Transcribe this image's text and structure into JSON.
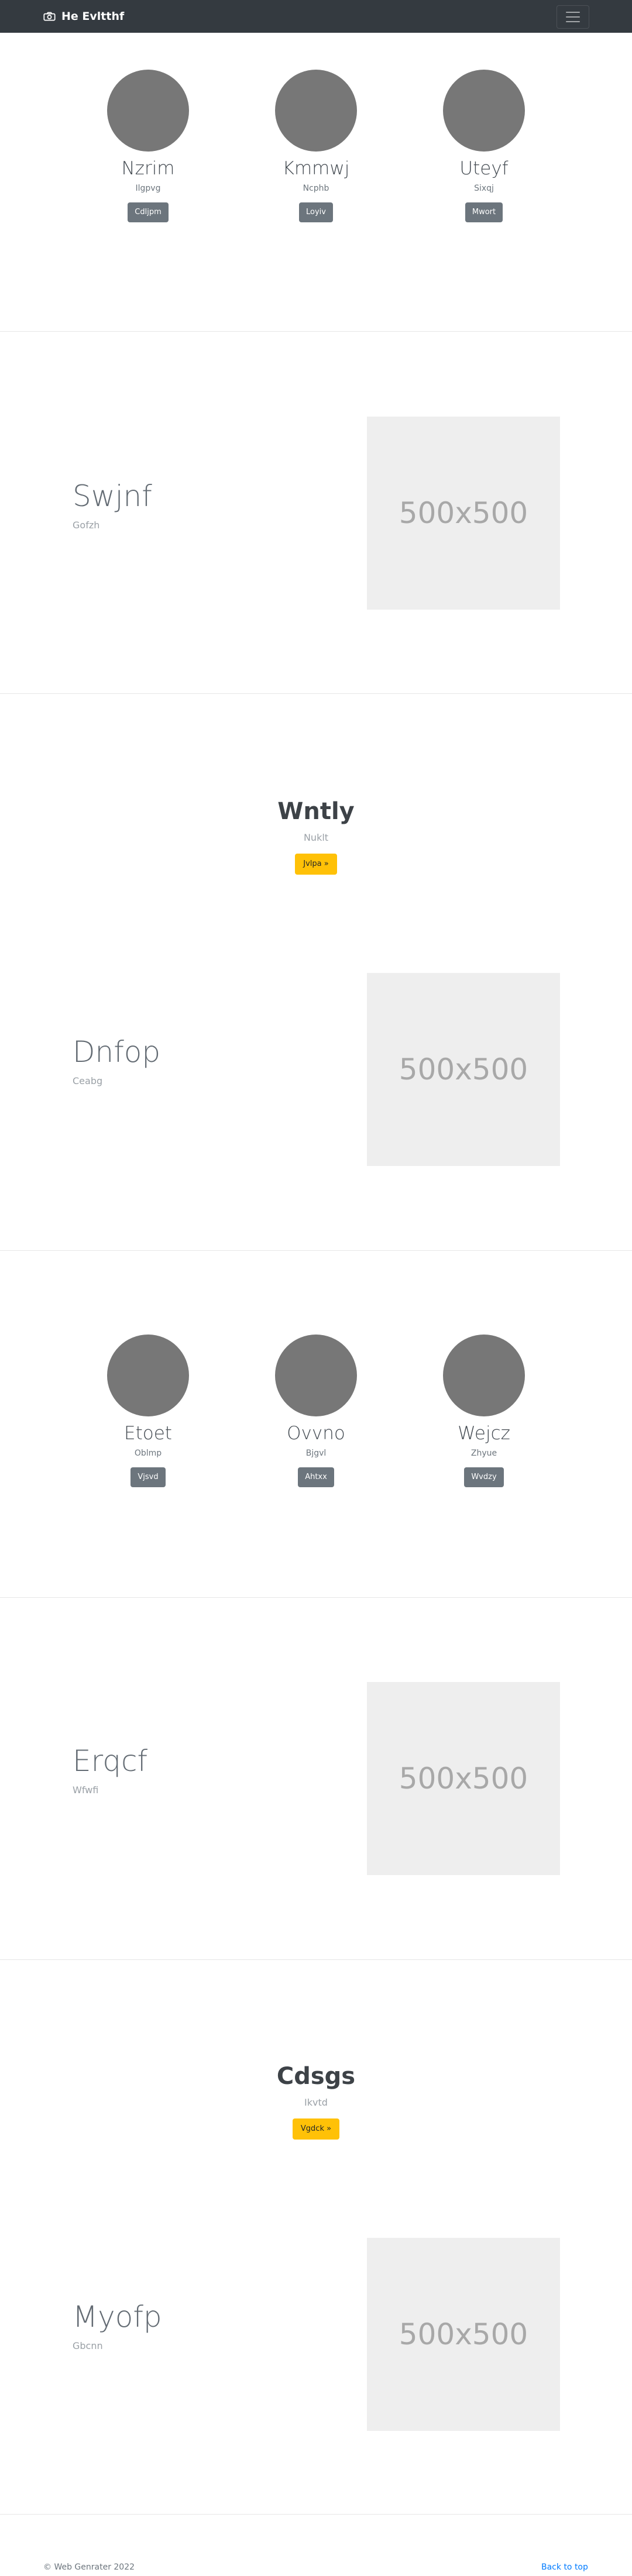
{
  "navbar": {
    "brand": "He Evltthf",
    "brand_icon": "camera-icon",
    "menu_icon": "hamburger-icon"
  },
  "team_1": [
    {
      "name": "Nzrim",
      "sub": "Ilgpvg",
      "button": "Cdljpm"
    },
    {
      "name": "Kmmwj",
      "sub": "Ncphb",
      "button": "Loyiv"
    },
    {
      "name": "Uteyf",
      "sub": "Sixqj",
      "button": "Mwort"
    }
  ],
  "feature_1": {
    "title": "Swjnf",
    "sub": "Gofzh",
    "placeholder": "500x500"
  },
  "cta_1": {
    "title": "Wntly",
    "sub": "Nuklt",
    "button": "Jvlpa »"
  },
  "feature_2": {
    "title": "Dnfop",
    "sub": "Ceabg",
    "placeholder": "500x500"
  },
  "team_2": [
    {
      "name": "Etoet",
      "sub": "Oblmp",
      "button": "Vjsvd"
    },
    {
      "name": "Ovvno",
      "sub": "Bjgvl",
      "button": "Ahtxx"
    },
    {
      "name": "Wejcz",
      "sub": "Zhyue",
      "button": "Wvdzy"
    }
  ],
  "feature_3": {
    "title": "Erqcf",
    "sub": "Wfwfi",
    "placeholder": "500x500"
  },
  "cta_2": {
    "title": "Cdsgs",
    "sub": "Ikvtd",
    "button": "Vgdck »"
  },
  "feature_4": {
    "title": "Myofp",
    "sub": "Gbcnn",
    "placeholder": "500x500"
  },
  "footer": {
    "copyright": "© Web Genrater 2022",
    "back_to_top": "Back to top"
  },
  "colors": {
    "navbar": "#343a40",
    "secondary": "#6c757d",
    "warning": "#ffc107",
    "link": "#007bff",
    "avatar": "#777777",
    "placeholder": "#eeeeee"
  }
}
